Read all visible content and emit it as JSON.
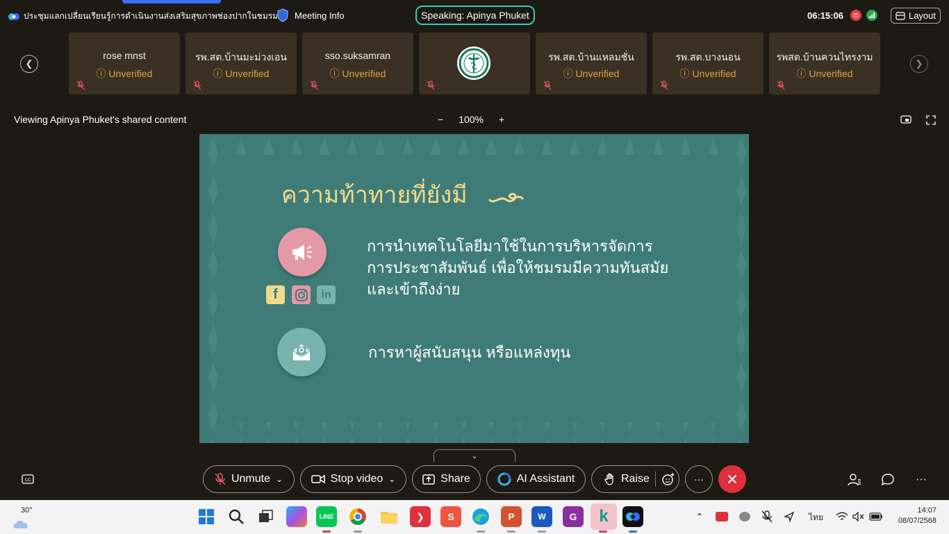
{
  "titlebar": {
    "meeting_title": "ประชุมแลกเปลี่ยนเรียนรู้การดำเนินงานส่งเสริมสุขภาพช่องปากในชมรม...",
    "meeting_info": "Meeting Info",
    "speaking": "Speaking: Apinya Phuket",
    "time": "06:15:06",
    "layout_label": "Layout"
  },
  "participants": [
    {
      "name": "rose mnst",
      "status": "Unverified"
    },
    {
      "name": "รพ.สต.บ้านมะม่วงเอน",
      "status": "Unverified"
    },
    {
      "name": "sso.suksamran",
      "status": "Unverified"
    },
    {
      "name": "",
      "status": "",
      "logo": "ministry-of-public-health-logo"
    },
    {
      "name": "รพ.สต.บ้านแหลมชั่น",
      "status": "Unverified"
    },
    {
      "name": "รพ.สต.บางนอน",
      "status": "Unverified"
    },
    {
      "name": "รพสต.บ้านควนไทรงาม",
      "status": "Unverified"
    }
  ],
  "share": {
    "viewing_label": "Viewing Apinya Phuket's shared content",
    "zoom_out": "−",
    "zoom_level": "100%",
    "zoom_in": "+"
  },
  "slide": {
    "title": "ความท้าทายที่ยังมี",
    "item1_lines": [
      "การนำเทคโนโลยีมาใช้ในการบริหารจัดการ",
      "การประชาสัมพันธ์ เพื่อให้ชมรมมีความทันสมัย",
      "และเข้าถึงง่าย"
    ],
    "item2": "การหาผู้สนับสนุน หรือแหล่งทุน",
    "colors": {
      "background": "#3f7c78",
      "title": "#f1d98b",
      "pink": "#e39aa4",
      "teal": "#78b4ad"
    }
  },
  "controls": {
    "unmute": "Unmute",
    "stop_video": "Stop video",
    "share": "Share",
    "ai_assistant": "AI Assistant",
    "raise": "Raise",
    "more": "···",
    "right_more": "···"
  },
  "taskbar": {
    "weather_temp": "30°",
    "language": "ไทย",
    "time": "14:07",
    "date": "08/07/2568"
  }
}
